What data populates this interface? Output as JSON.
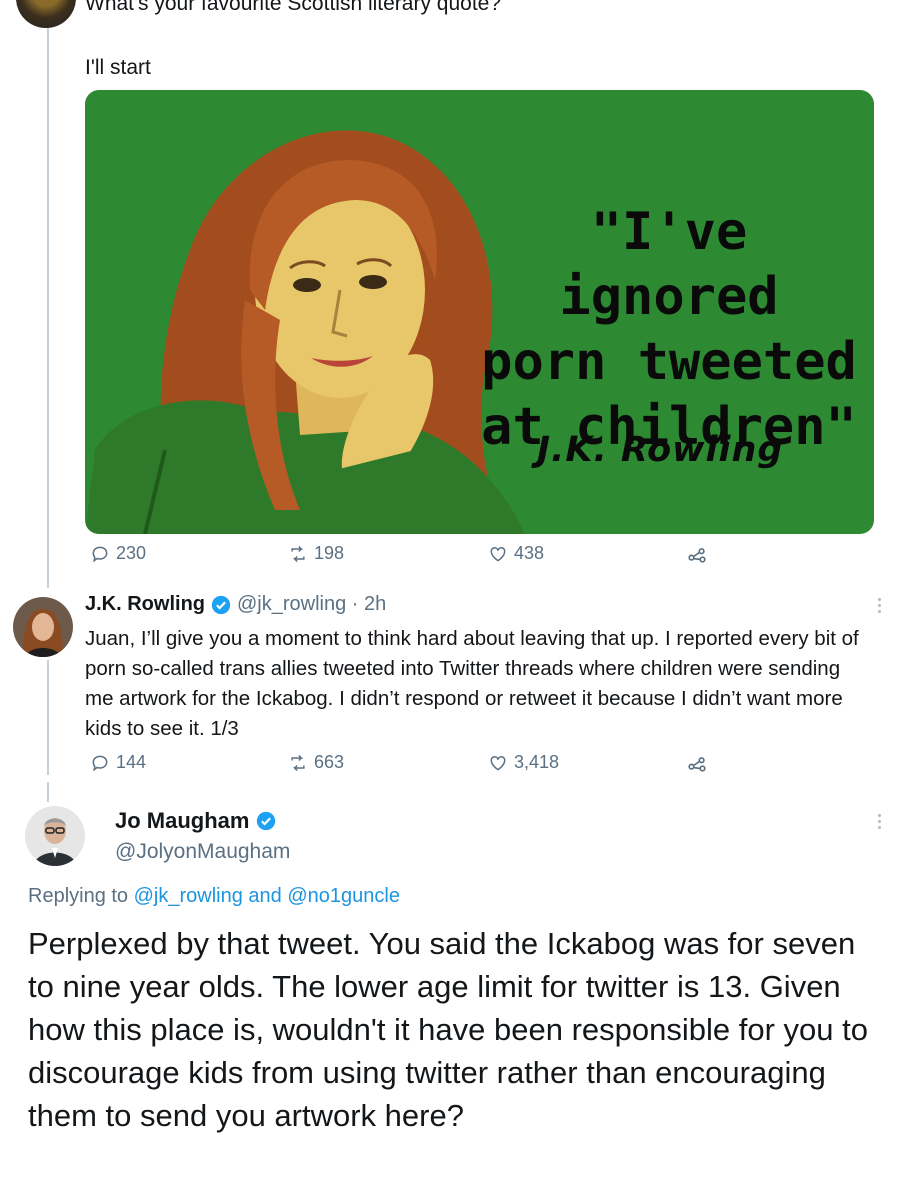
{
  "colors": {
    "accent": "#1b95e0",
    "secondary_text": "#5b7083",
    "image_background": "#2d8a32"
  },
  "first_tweet": {
    "question": "What's your favourite Scottish literary quote?",
    "intro": "I'll start",
    "image": {
      "quote_lines": [
        "\"I've ignored",
        "porn tweeted",
        "at children\""
      ],
      "author": "J.K. Rowling"
    },
    "actions": {
      "replies": "230",
      "retweets": "198",
      "likes": "438"
    }
  },
  "rowling_reply": {
    "display_name": "J.K. Rowling",
    "handle_time": "@jk_rowling · 2h",
    "body": "Juan, I’ll give you a moment to think hard about leaving that up. I reported every bit of porn so-called trans allies tweeted into Twitter threads where children were sending me artwork for the Ickabog. I didn’t respond or retweet it because I didn’t want more kids to see it. 1/3",
    "actions": {
      "replies": "144",
      "retweets": "663",
      "likes": "3,418"
    }
  },
  "maugham_reply": {
    "display_name": "Jo Maugham",
    "handle": "@JolyonMaugham",
    "replying_prefix": "Replying to ",
    "replying_user1": "@jk_rowling",
    "replying_and": " and ",
    "replying_user2": "@no1guncle",
    "body": "Perplexed by that tweet. You said the Ickabog was for seven to nine year olds. The lower age limit for twitter is 13. Given how this place is, wouldn't it have been responsible for you to discourage kids from using twitter rather than encouraging them to send you artwork here?"
  }
}
